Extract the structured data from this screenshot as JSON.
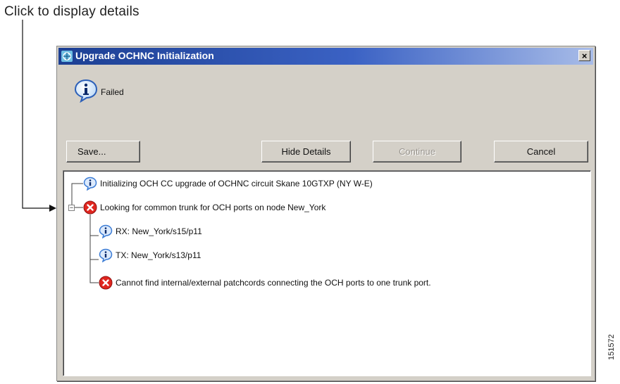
{
  "callout": {
    "text": "Click to display details"
  },
  "dialog": {
    "title": "Upgrade OCHNC Initialization",
    "close_label": "×",
    "status_text": "Failed",
    "buttons": {
      "save": "Save...",
      "hide_details": "Hide Details",
      "continue": "Continue",
      "cancel": "Cancel"
    },
    "details": [
      {
        "level": 0,
        "status": "info",
        "text": "Initializing OCH CC upgrade of OCHNC circuit Skane 10GTXP (NY W-E)"
      },
      {
        "level": 0,
        "status": "error",
        "expanded": true,
        "text": "Looking for common trunk for OCH ports on node New_York"
      },
      {
        "level": 1,
        "status": "info",
        "text": "RX: New_York/s15/p11"
      },
      {
        "level": 1,
        "status": "info",
        "text": "TX: New_York/s13/p11"
      },
      {
        "level": 1,
        "status": "error",
        "text": "Cannot find internal/external patchcords connecting the OCH ports to one trunk port."
      }
    ]
  },
  "figure_id": "151572",
  "icons": {
    "app": "network-app-icon",
    "status": "info-bubble-icon",
    "info": "info-icon",
    "error": "error-icon"
  },
  "colors": {
    "titlebar": "#1c3f93",
    "error": "#e0261f",
    "info": "#3a7bd5"
  }
}
